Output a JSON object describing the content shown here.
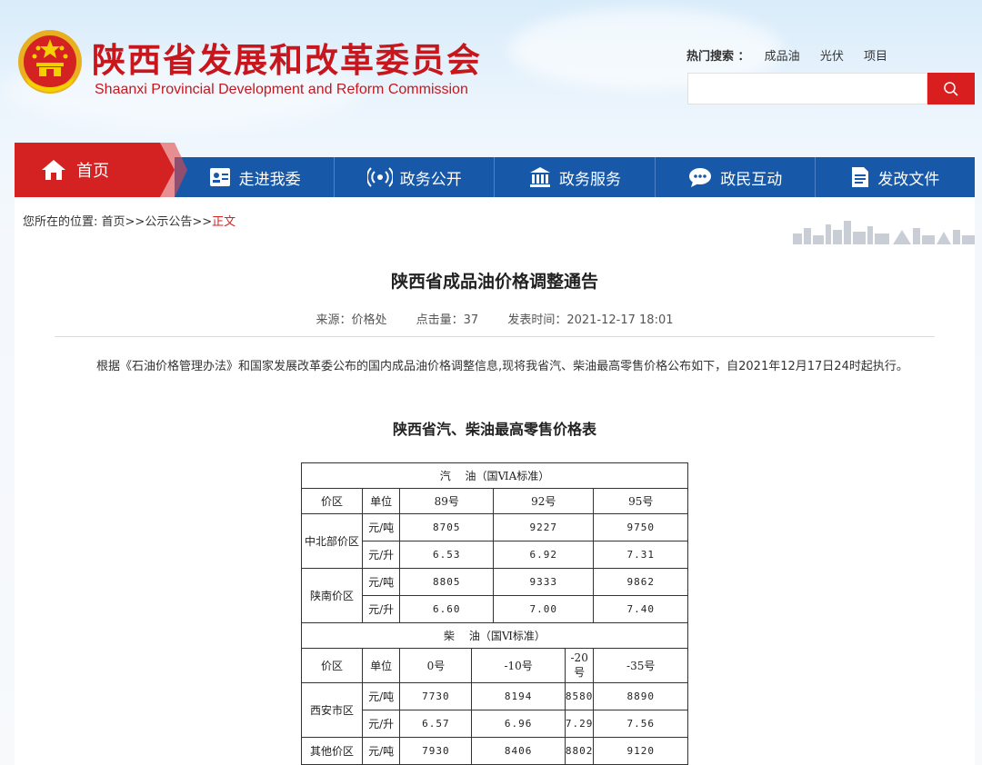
{
  "site": {
    "title_cn": "陕西省发展和改革委员会",
    "title_en": "Shaanxi Provincial Development and Reform Commission"
  },
  "hot_search": {
    "label": "热门搜索 ：",
    "items": [
      "成品油",
      "光伏",
      "项目"
    ]
  },
  "search": {
    "placeholder": ""
  },
  "nav": {
    "home": "首页",
    "items": [
      "走进我委",
      "政务公开",
      "政务服务",
      "政民互动",
      "发改文件"
    ]
  },
  "breadcrumb": {
    "prefix": "您所在的位置: ",
    "home": "首页",
    "sep1": ">>",
    "section": "公示公告",
    "sep2": ">>",
    "current": "正文"
  },
  "article": {
    "title": "陕西省成品油价格调整通告",
    "source": "来源：价格处",
    "clicks": "点击量：37",
    "published": "发表时间：2021-12-17 18:01",
    "body": "根据《石油价格管理办法》和国家发展改革委公布的国内成品油价格调整信息,现将我省汽、柴油最高零售价格公布如下，自2021年12月17日24时起执行。",
    "table_title": "陕西省汽、柴油最高零售价格表"
  },
  "gasoline": {
    "header": "汽　 油（国ⅥA标准）",
    "col_region": "价区",
    "col_unit": "单位",
    "grades": [
      "89号",
      "92号",
      "95号"
    ],
    "rows": [
      {
        "region": "中北部价区",
        "unit_ton": "元/吨",
        "ton": [
          "8705",
          "9227",
          "9750"
        ],
        "unit_liter": "元/升",
        "liter": [
          "6.53",
          "6.92",
          "7.31"
        ]
      },
      {
        "region": "陕南价区",
        "unit_ton": "元/吨",
        "ton": [
          "8805",
          "9333",
          "9862"
        ],
        "unit_liter": "元/升",
        "liter": [
          "6.60",
          "7.00",
          "7.40"
        ]
      }
    ]
  },
  "diesel": {
    "header": "柴　 油（国Ⅵ标准）",
    "col_region": "价区",
    "col_unit": "单位",
    "grades": [
      "0号",
      "-10号",
      "-20号",
      "-35号"
    ],
    "rows": [
      {
        "region": "西安市区",
        "unit_ton": "元/吨",
        "ton": [
          "7730",
          "8194",
          "8580",
          "8890"
        ],
        "unit_liter": "元/升",
        "liter": [
          "6.57",
          "6.96",
          "7.29",
          "7.56"
        ]
      },
      {
        "region": "其他价区",
        "unit_ton": "元/吨",
        "ton": [
          "7930",
          "8406",
          "8802",
          "9120"
        ]
      }
    ]
  },
  "colors": {
    "brand_red": "#c8161d",
    "nav_blue": "#1758a8",
    "home_red": "#d42121"
  }
}
